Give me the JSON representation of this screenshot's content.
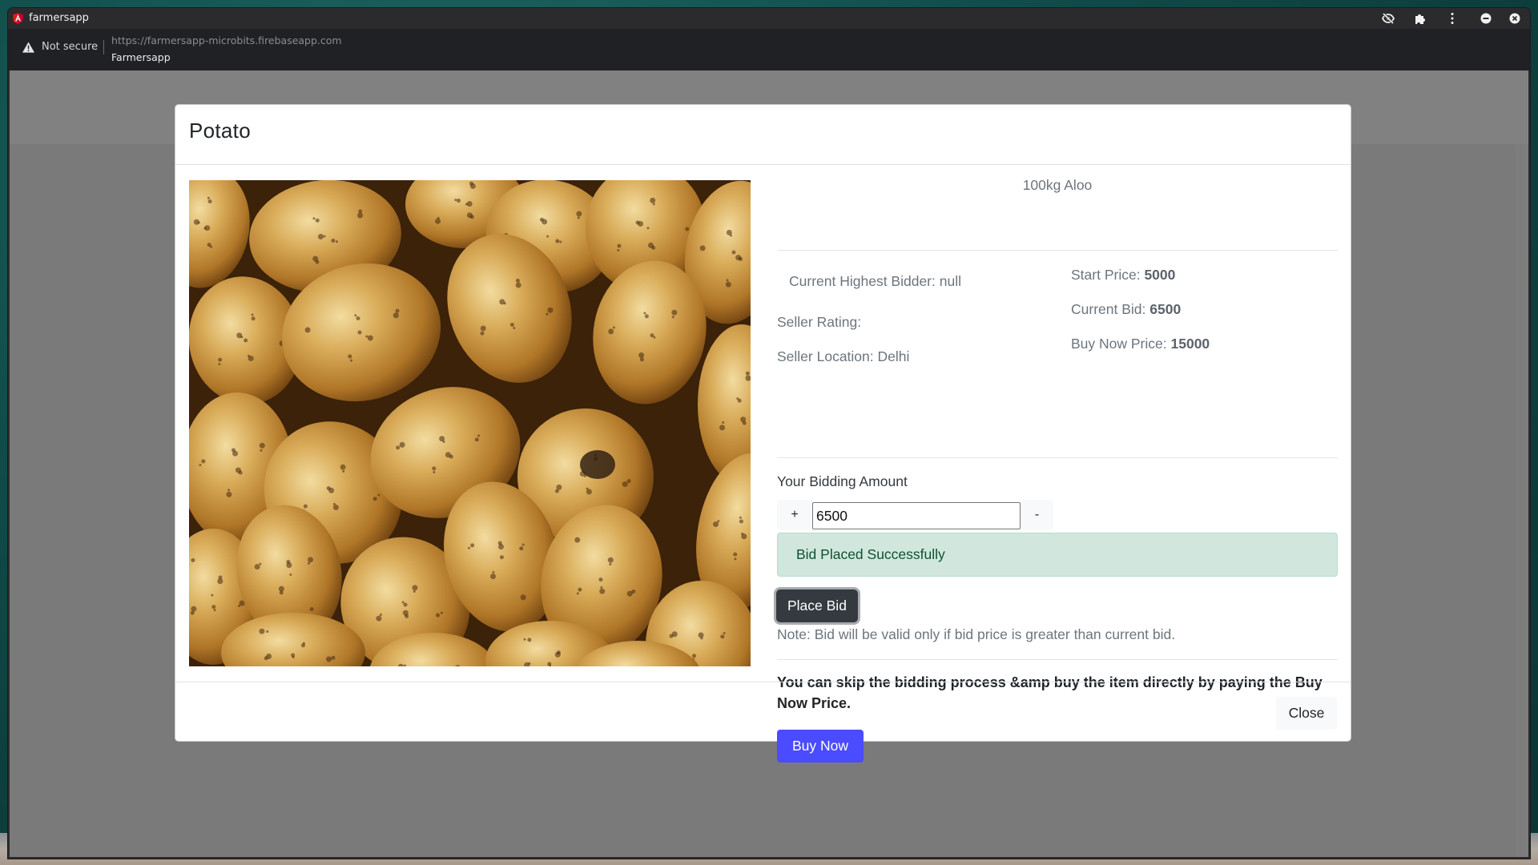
{
  "browser": {
    "window_title": "farmersapp",
    "security_label": "Not secure",
    "url": "https://farmersapp-microbits.firebaseapp.com",
    "page_title": "Farmersapp",
    "toolbar_icons": [
      "eye-off-icon",
      "puzzle-extension-icon",
      "kebab-menu-icon",
      "minimize-icon",
      "close-window-icon"
    ]
  },
  "modal": {
    "title": "Potato",
    "image_alt": "Pile of potatoes",
    "description": "100kg Aloo",
    "left_info": {
      "highest_bidder_label": "Current Highest Bidder:",
      "highest_bidder_value": "null",
      "seller_rating_label": "Seller Rating:",
      "seller_rating_value": "",
      "seller_location_label": "Seller Location:",
      "seller_location_value": "Delhi"
    },
    "right_info": {
      "start_price_label": "Start Price:",
      "start_price_value": "5000",
      "current_bid_label": "Current Bid:",
      "current_bid_value": "6500",
      "buy_now_price_label": "Buy Now Price:",
      "buy_now_price_value": "15000"
    },
    "bidding": {
      "label": "Your Bidding Amount",
      "increment_label": "+",
      "decrement_label": "-",
      "amount_value": "6500",
      "success_message": "Bid Placed Successfully",
      "place_bid_label": "Place Bid",
      "note": "Note: Bid will be valid only if bid price is greater than current bid."
    },
    "buy_now": {
      "info": "You can skip the bidding process &amp buy the item directly by paying the Buy Now Price.",
      "button_label": "Buy Now"
    },
    "footer": {
      "close_label": "Close"
    },
    "colors": {
      "buy_now": "#4b4bff",
      "place_bid": "#343a40",
      "success_bg": "#d1e7dd",
      "success_text": "#0f5132",
      "backdrop": "#7a7a7a"
    }
  }
}
